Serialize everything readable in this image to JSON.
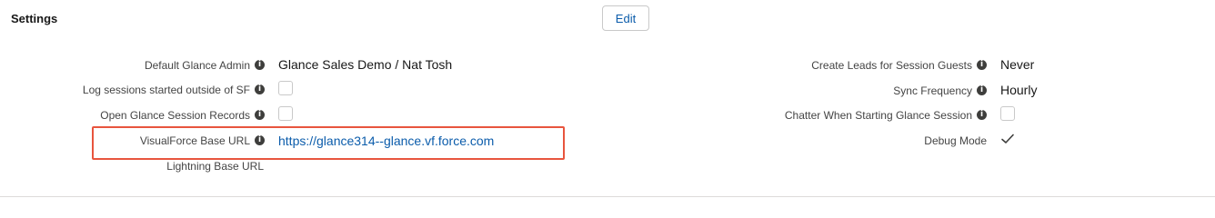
{
  "section": {
    "title": "Settings",
    "edit_label": "Edit"
  },
  "left_fields": [
    {
      "label": "Default Glance Admin",
      "value": "Glance Sales Demo / Nat Tosh",
      "type": "text"
    },
    {
      "label": "Log sessions started outside of SF",
      "value": "",
      "type": "checkbox",
      "checked": false
    },
    {
      "label": "Open Glance Session Records",
      "value": "",
      "type": "checkbox",
      "checked": false
    },
    {
      "label": "VisualForce Base URL",
      "value": "https://glance314--glance.vf.force.com",
      "type": "link"
    },
    {
      "label": "Lightning Base URL",
      "value": "",
      "type": "text"
    }
  ],
  "right_fields": [
    {
      "label": "Create Leads for Session Guests",
      "value": "Never",
      "type": "text"
    },
    {
      "label": "Sync Frequency",
      "value": "Hourly",
      "type": "text"
    },
    {
      "label": "Chatter When Starting Glance Session",
      "value": "",
      "type": "checkbox",
      "checked": false
    },
    {
      "label": "Debug Mode",
      "value": "",
      "type": "checkbox",
      "checked": true
    }
  ],
  "icons": {
    "info": "info-icon",
    "check": "check-icon"
  },
  "colors": {
    "link": "#0b5cab",
    "highlight": "#e8553e",
    "label": "#444444"
  }
}
